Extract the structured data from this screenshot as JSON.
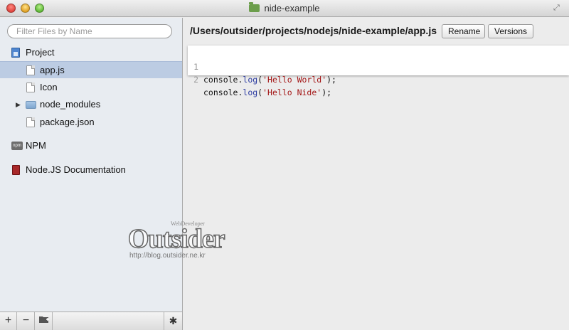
{
  "window": {
    "title": "nide-example",
    "fullscreen_icon": "fullscreen-arrows-icon"
  },
  "sidebar": {
    "search": {
      "placeholder": "Filter Files by Name",
      "value": ""
    },
    "project_label": "Project",
    "files": [
      {
        "label": "app.js",
        "icon": "file-icon",
        "selected": true
      },
      {
        "label": "Icon",
        "icon": "file-icon",
        "selected": false
      },
      {
        "label": "node_modules",
        "icon": "folder-icon",
        "selected": false,
        "collapsed": true
      },
      {
        "label": "package.json",
        "icon": "file-icon",
        "selected": false
      }
    ],
    "npm_label": "NPM",
    "npm_icon_text": "npm",
    "docs_label": "Node.JS Documentation",
    "toolbar": {
      "add": "+",
      "remove": "−",
      "new_folder_icon": "new-folder-icon",
      "gear": "✱"
    }
  },
  "main": {
    "path": "/Users/outsider/projects/nodejs/nide-example/app.js",
    "rename_label": "Rename",
    "versions_label": "Versions",
    "code_lines": [
      {
        "num": "1",
        "text": "console.log('Hello World');"
      },
      {
        "num": "2",
        "text": "console.log('Hello Nide');"
      }
    ]
  },
  "watermark": {
    "small": "WebDeveloper",
    "main": "Outsider",
    "url": "http://blog.outsider.ne.kr"
  },
  "colors": {
    "selection": "#bccce3",
    "string": "#a31515",
    "function": "#2a3aa0"
  }
}
